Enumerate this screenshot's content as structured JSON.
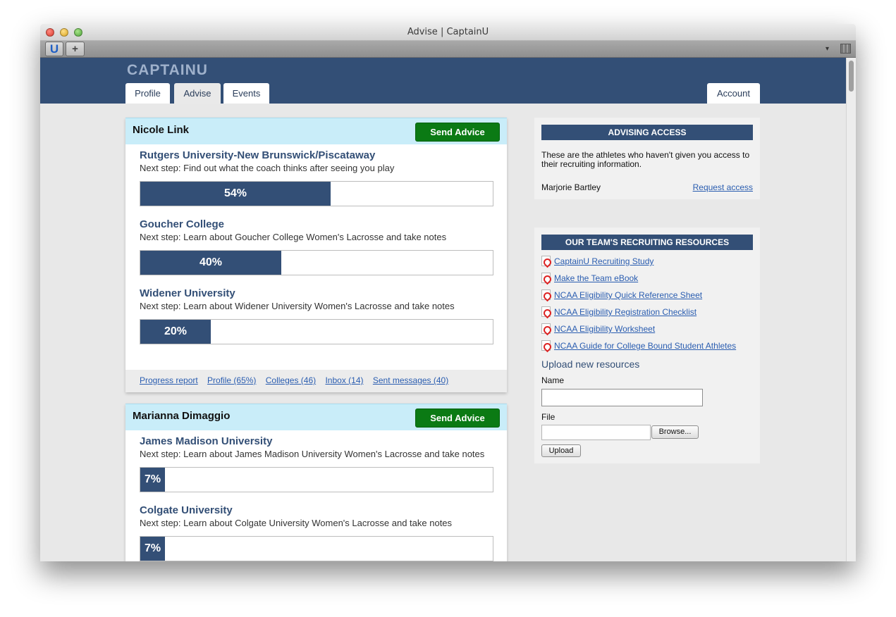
{
  "window": {
    "title": "Advise | CaptainU"
  },
  "browser": {
    "u_tab": "U",
    "new_tab": "+",
    "menu_arrow": "▾"
  },
  "site": {
    "logo": "CAPTAINU",
    "tabs": [
      {
        "label": "Profile"
      },
      {
        "label": "Advise"
      },
      {
        "label": "Events"
      }
    ],
    "account_label": "Account"
  },
  "athletes": [
    {
      "name": "Nicole Link",
      "send_label": "Send Advice",
      "colleges": [
        {
          "name": "Rutgers University-New Brunswick/Piscataway",
          "next_step": "Next step: Find out what the coach thinks after seeing you play",
          "progress": 54,
          "progress_label": "54%"
        },
        {
          "name": "Goucher College",
          "next_step": "Next step: Learn about Goucher College Women's Lacrosse and take notes",
          "progress": 40,
          "progress_label": "40%"
        },
        {
          "name": "Widener University",
          "next_step": "Next step: Learn about Widener University Women's Lacrosse and take notes",
          "progress": 20,
          "progress_label": "20%"
        }
      ],
      "links": [
        "Progress report",
        "Profile (65%)",
        "Colleges (46)",
        "Inbox (14)",
        "Sent messages (40)"
      ]
    },
    {
      "name": "Marianna Dimaggio",
      "send_label": "Send Advice",
      "colleges": [
        {
          "name": "James Madison University",
          "next_step": "Next step: Learn about James Madison University Women's Lacrosse and take notes",
          "progress": 7,
          "progress_label": "7%"
        },
        {
          "name": "Colgate University",
          "next_step": "Next step: Learn about Colgate University Women's Lacrosse and take notes",
          "progress": 7,
          "progress_label": "7%"
        }
      ]
    }
  ],
  "advising_access": {
    "title": "ADVISING ACCESS",
    "text": "These are the athletes who haven't given you access to their recruiting information.",
    "athlete": "Marjorie Bartley",
    "request_label": "Request access"
  },
  "resources": {
    "title": "OUR TEAM'S RECRUITING RESOURCES",
    "items": [
      "CaptainU Recruiting Study",
      "Make the Team eBook",
      "NCAA Eligibility Quick Reference Sheet",
      "NCAA Eligibility Registration Checklist",
      "NCAA Eligibility Worksheet",
      "NCAA Guide for College Bound Student Athletes"
    ],
    "upload_title": "Upload new resources",
    "name_label": "Name",
    "file_label": "File",
    "browse_label": "Browse...",
    "upload_label": "Upload"
  },
  "colors": {
    "brand_navy": "#334f76",
    "send_green": "#0b7a14",
    "card_head": "#c9edf9",
    "link_blue": "#2a5db0"
  }
}
